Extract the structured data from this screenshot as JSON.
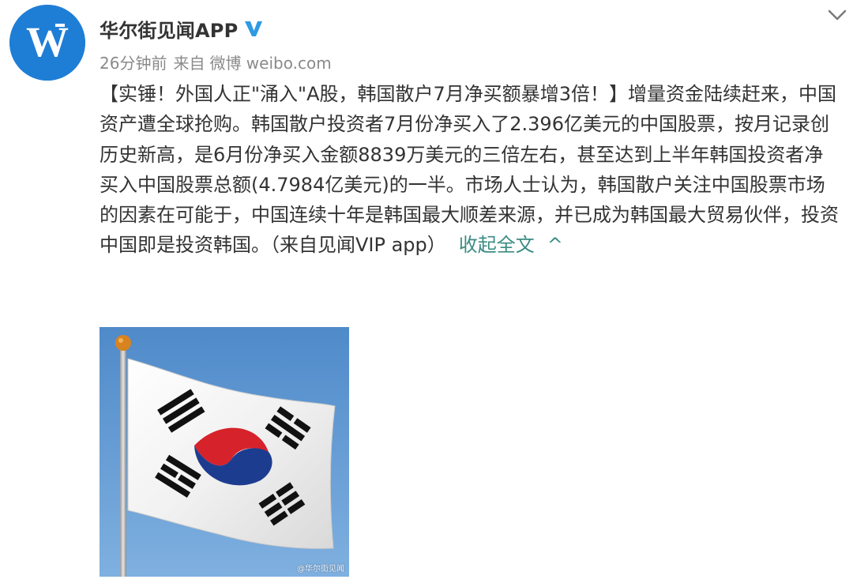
{
  "post": {
    "author": "华尔街见闻APP",
    "time": "26分钟前",
    "from_label": "来自",
    "source": "微博 weibo.com",
    "content": "【实锤！外国人正\"涌入\"A股，韩国散户7月净买额暴增3倍！】增量资金陆续赶来，中国资产遭全球抢购。韩国散户投资者7月份净买入了2.396亿美元的中国股票，按月记录创历史新高，是6月份净买入金额8839万美元的三倍左右，甚至达到上半年韩国投资者净买入中国股票总额(4.7984亿美元)的一半。市场人士认为，韩国散户关注中国股票市场的因素在可能于，中国连续十年是韩国最大顺差来源，并已成为韩国最大贸易伙伴，投资中国即是投资韩国。（来自见闻VIP app）",
    "collapse_label": "收起全文",
    "collapse_arrow": "^",
    "image_watermark": "@华尔街见闻"
  },
  "icons": {
    "avatar": "wallstreetcn-logo",
    "verified": "verified-v-icon",
    "dropdown": "chevron-down-icon",
    "collapse": "chevron-up-icon"
  },
  "colors": {
    "avatar_bg": "#1e7ed6",
    "verified": "#2f9ae3",
    "link": "#3b8c83",
    "meta": "#8a8a8a",
    "text": "#333333"
  }
}
